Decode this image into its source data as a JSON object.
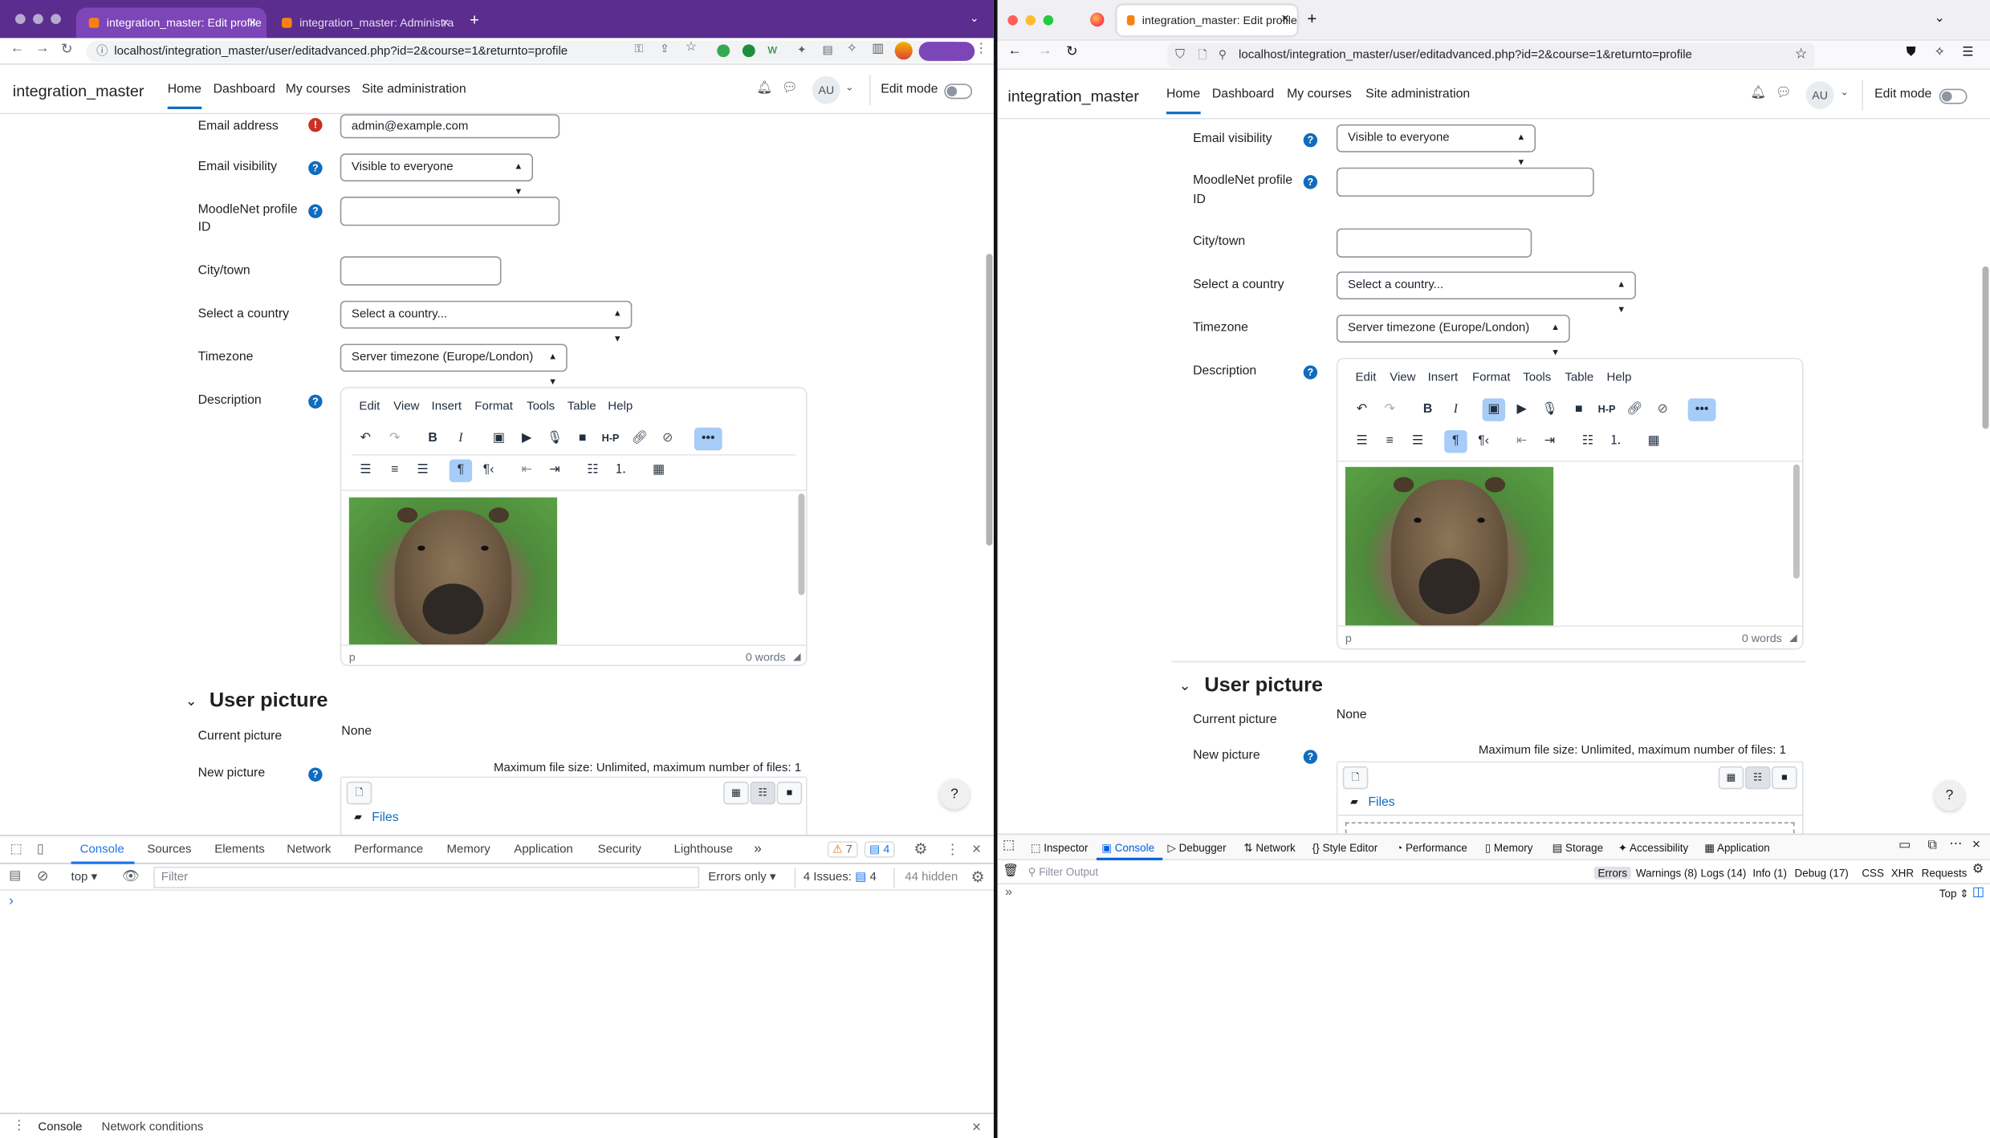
{
  "chrome": {
    "tabs": [
      {
        "title": "integration_master: Edit profile"
      },
      {
        "title": "integration_master: Administra"
      }
    ],
    "new_tab": "+",
    "close": "×",
    "url": "localhost/integration_master/user/editadvanced.php?id=2&course=1&returnto=profile"
  },
  "firefox": {
    "tab_title": "integration_master: Edit profile",
    "close": "×",
    "new_tab": "+",
    "url": "localhost/integration_master/user/editadvanced.php?id=2&course=1&returnto=profile"
  },
  "site": {
    "brand": "integration_master",
    "nav": [
      "Home",
      "Dashboard",
      "My courses",
      "Site administration"
    ],
    "avatar": "AU",
    "edit_mode": "Edit mode"
  },
  "form": {
    "email_label": "Email address",
    "email_value": "admin@example.com",
    "email_visibility_label": "Email visibility",
    "email_visibility_value": "Visible to everyone",
    "moodlenet_label_1": "MoodleNet profile",
    "moodlenet_label_2": "ID",
    "city_label": "City/town",
    "country_label": "Select a country",
    "country_value": "Select a country...",
    "timezone_label": "Timezone",
    "timezone_value": "Server timezone (Europe/London)",
    "description_label": "Description",
    "help": "?",
    "required": "!"
  },
  "editor": {
    "menu": [
      "Edit",
      "View",
      "Insert",
      "Format",
      "Tools",
      "Table",
      "Help"
    ],
    "status_path": "p",
    "word_count": "0 words"
  },
  "picture": {
    "section_title": "User picture",
    "current_label": "Current picture",
    "current_value": "None",
    "new_label": "New picture",
    "max_size": "Maximum file size: Unlimited, maximum number of files: 1",
    "files": "Files"
  },
  "chrome_devtools": {
    "tabs": [
      "Console",
      "Sources",
      "Elements",
      "Network",
      "Performance",
      "Memory",
      "Application",
      "Security",
      "Lighthouse"
    ],
    "more": "»",
    "warnings": "7",
    "messages": "4",
    "context": "top",
    "filter_placeholder": "Filter",
    "levels": "Errors only",
    "issues_label": "4 Issues:",
    "issues_count": "4",
    "hidden": "44 hidden",
    "prompt": "›",
    "drawer_tabs": [
      "Console",
      "Network conditions"
    ]
  },
  "firefox_devtools": {
    "tabs": [
      "Inspector",
      "Console",
      "Debugger",
      "Network",
      "Style Editor",
      "Performance",
      "Memory",
      "Storage",
      "Accessibility",
      "Application"
    ],
    "filter_placeholder": "Filter Output",
    "levels": [
      "Errors",
      "Warnings (8)",
      "Logs (14)",
      "Info (1)",
      "Debug (17)"
    ],
    "types": [
      "CSS",
      "XHR",
      "Requests"
    ],
    "prompt": "»",
    "context": "Top"
  },
  "colors": {
    "chrome_purple": "#5b2d8e",
    "moodle_blue": "#0f6cbf",
    "required_red": "#ca3120",
    "active_button": "#a6ccf7"
  }
}
